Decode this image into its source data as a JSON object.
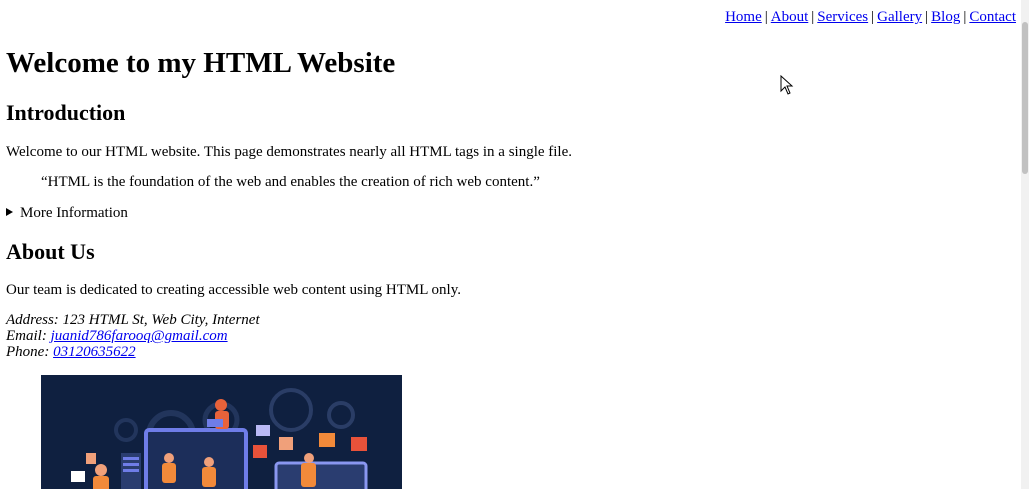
{
  "nav": {
    "links": [
      "Home",
      "About",
      "Services",
      "Gallery",
      "Blog",
      "Contact"
    ],
    "separator": "|"
  },
  "page": {
    "title": "Welcome to my HTML Website"
  },
  "introduction": {
    "heading": "Introduction",
    "text": "Welcome to our HTML website. This page demonstrates nearly all HTML tags in a single file.",
    "quote": "“HTML is the foundation of the web and enables the creation of rich web content.”",
    "details_summary": "More Information"
  },
  "about": {
    "heading": "About Us",
    "text": "Our team is dedicated to creating accessible web content using HTML only.",
    "address_line": "Address: 123 HTML St, Web City, Internet",
    "email_label": "Email: ",
    "email": "juanid786farooq@gmail.com",
    "phone_label": "Phone: ",
    "phone": "03120635622"
  },
  "colors": {
    "link": "#0000ee",
    "image_bg": "#0f2040"
  }
}
